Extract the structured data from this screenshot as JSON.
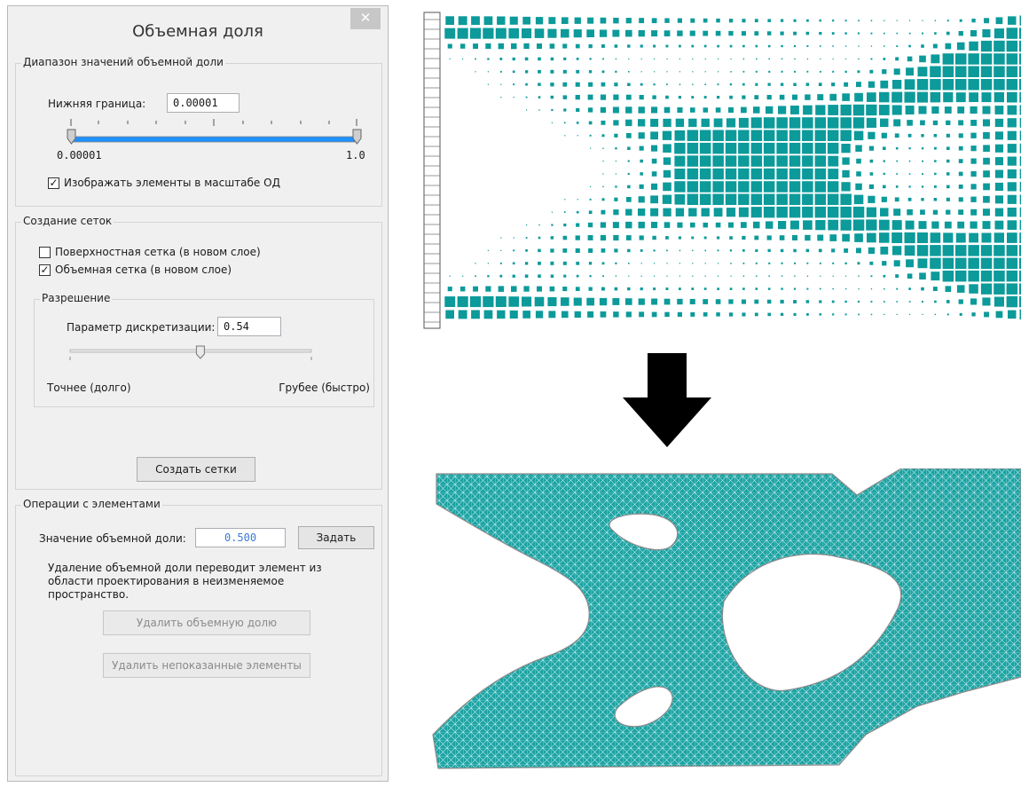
{
  "dialog": {
    "title": "Объемная доля",
    "close_glyph": "✕",
    "range_group": {
      "legend": "Диапазон значений объемной доли",
      "lower_bound_label": "Нижняя граница:",
      "lower_bound_value": "0.00001",
      "slider_min_label": "0.00001",
      "slider_max_label": "1.0",
      "scale_checkbox_label": "Изображать элементы в масштабе ОД",
      "scale_checked": true
    },
    "mesh_group": {
      "legend": "Создание сеток",
      "surface_mesh_label": "Поверхностная сетка (в новом слое)",
      "surface_mesh_checked": false,
      "volume_mesh_label": "Объемная сетка (в новом слое)",
      "volume_mesh_checked": true,
      "resolution": {
        "legend": "Разрешение",
        "param_label": "Параметр дискретизации:",
        "param_value": "0.54",
        "slider_fraction": 0.54,
        "fine_label": "Точнее (долго)",
        "coarse_label": "Грубее (быстро)"
      },
      "create_button": "Создать сетки"
    },
    "elements_group": {
      "legend": "Операции с элементами",
      "value_label": "Значение объемной доли:",
      "value": "0.500",
      "set_button": "Задать",
      "note": "Удаление объемной доли переводит элемент из области проектирования в неизменяемое пространство.",
      "delete_fraction_button": "Удалить объемную долю",
      "delete_hidden_button": "Удалить непоказанные элементы"
    }
  },
  "colors": {
    "accent": "#0c9a9a",
    "slider_blue": "#1e90ff",
    "value_blue": "#3a7bd5"
  },
  "visuals": {
    "voxel_view": "voxel-density-plot",
    "arrow": "down-arrow",
    "mesh_view": "triangulated-mesh"
  }
}
